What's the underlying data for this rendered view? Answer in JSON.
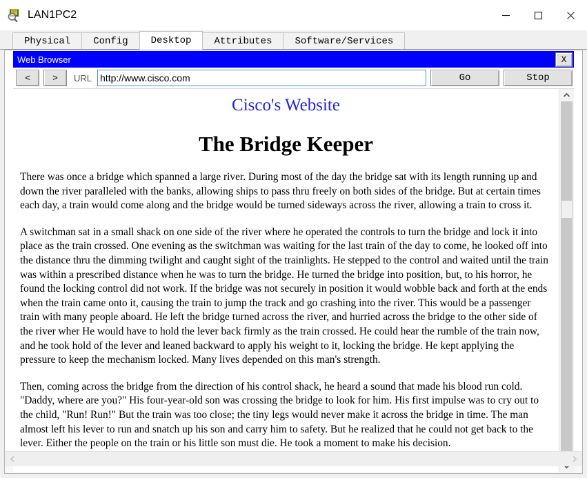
{
  "window": {
    "title": "LAN1PC2",
    "icon": "packet-tracer-pc-icon",
    "controls": {
      "minimize": "minimize-icon",
      "maximize": "maximize-icon",
      "close": "close-icon"
    }
  },
  "tabs": [
    {
      "label": "Physical",
      "active": false
    },
    {
      "label": "Config",
      "active": false
    },
    {
      "label": "Desktop",
      "active": true
    },
    {
      "label": "Attributes",
      "active": false
    },
    {
      "label": "Software/Services",
      "active": false
    }
  ],
  "browser": {
    "title": "Web Browser",
    "title_bar_color": "#0000ff",
    "close_label": "X",
    "toolbar": {
      "back_label": "<",
      "forward_label": ">",
      "url_label": "URL",
      "url_value": "http://www.cisco.com",
      "url_placeholder": "http://",
      "go_label": "Go",
      "stop_label": "Stop"
    },
    "page": {
      "site_link": "Cisco's Website",
      "site_link_color": "#2222dd",
      "heading": "The Bridge Keeper",
      "paragraphs": [
        "There was once a bridge which spanned a large river. During most of the day the bridge sat with its length running up and down the river paralleled with the banks, allowing ships to pass thru freely on both sides of the bridge. But at certain times each day, a train would come along and the bridge would be turned sideways across the river, allowing a train to cross it.",
        "A switchman sat in a small shack on one side of the river where he operated the controls to turn the bridge and lock it into place as the train crossed. One evening as the switchman was waiting for the last train of the day to come, he looked off into the distance thru the dimming twilight and caught sight of the trainlights. He stepped to the control and waited until the train was within a prescribed distance when he was to turn the bridge. He turned the bridge into position, but, to his horror, he found the locking control did not work. If the bridge was not securely in position it would wobble back and forth at the ends when the train came onto it, causing the train to jump the track and go crashing into the river. This would be a passenger train with many people aboard. He left the bridge turned across the river, and hurried across the bridge to the other side of the river wher He would have to hold the lever back firmly as the train crossed. He could hear the rumble of the train now, and he took hold of the lever and leaned backward to apply his weight to it, locking the bridge. He kept applying the pressure to keep the mechanism locked. Many lives depended on this man's strength.",
        "Then, coming across the bridge from the direction of his control shack, he heard a sound that made his blood run cold. \"Daddy, where are you?\" His four-year-old son was crossing the bridge to look for him. His first impulse was to cry out to the child, \"Run! Run!\" But the train was too close; the tiny legs would never make it across the bridge in time. The man almost left his lever to run and snatch up his son and carry him to safety. But he realized that he could not get back to the lever. Either the people on the train or his little son must die. He took a moment to make his decision."
      ]
    },
    "scrollbars": {
      "vertical_up": "chevron-up-icon",
      "vertical_down": "chevron-down-icon",
      "horizontal_left": "chevron-left-icon",
      "horizontal_right": "chevron-right-icon"
    }
  }
}
